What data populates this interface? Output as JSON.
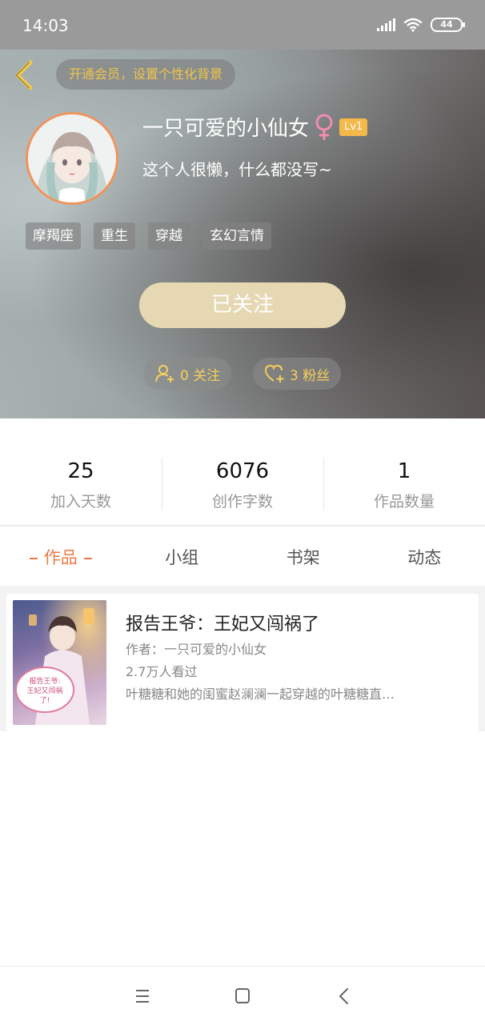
{
  "status_bar": {
    "time": "14:03",
    "battery": "44"
  },
  "header": {
    "vip_banner": "开通会员，设置个性化背景"
  },
  "profile": {
    "name": "一只可爱的小仙女",
    "level": "Lv1",
    "bio": "这个人很懒，什么都没写~",
    "tags": [
      "摩羯座",
      "重生",
      "穿越",
      "玄幻言情"
    ],
    "follow_button": "已关注",
    "following_label": "0 关注",
    "fans_label": "3 粉丝"
  },
  "stats": [
    {
      "value": "25",
      "label": "加入天数"
    },
    {
      "value": "6076",
      "label": "创作字数"
    },
    {
      "value": "1",
      "label": "作品数量"
    }
  ],
  "tabs": [
    "作品",
    "小组",
    "书架",
    "动态"
  ],
  "book": {
    "title": "报告王爷：王妃又闯祸了",
    "author": "作者：一只可爱的小仙女",
    "views": "2.7万人看过",
    "description": "叶糖糖和她的闺蜜赵澜澜一起穿越的叶糖糖直…",
    "cover_text": "报告王爷：王妃又闯祸了！"
  },
  "colors": {
    "accent": "#f07a45",
    "vip": "#f0c54a",
    "follow_button": "#e6d8b2",
    "avatar_border": "#f0935c"
  },
  "icons": {
    "back": "chevron-left-icon",
    "female": "female-symbol-icon",
    "following": "person-add-icon",
    "fans": "heart-plus-icon",
    "nav_menu": "menu-icon",
    "nav_home": "square-icon",
    "nav_back": "chevron-left-icon"
  }
}
